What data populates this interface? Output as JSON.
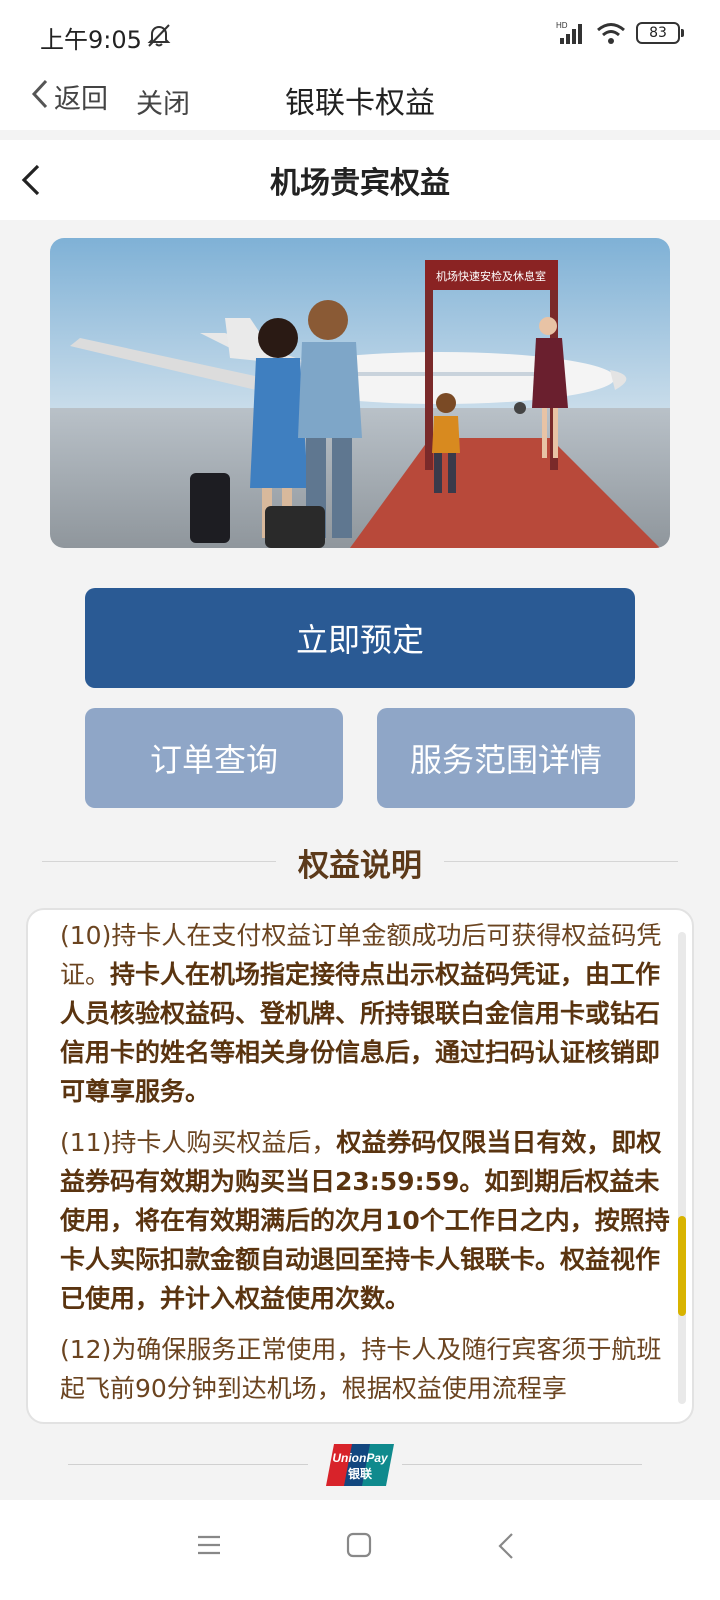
{
  "status_bar": {
    "time": "上午9:05",
    "battery": "83",
    "network": "HD"
  },
  "nav": {
    "back_label": "返回",
    "close_label": "关闭",
    "title": "银联卡权益"
  },
  "page": {
    "title": "机场贵宾权益"
  },
  "banner": {
    "sign_text": "机场快速安检及休息室"
  },
  "actions": {
    "primary": "立即预定",
    "orders": "订单查询",
    "scope": "服务范围详情"
  },
  "section": {
    "title": "权益说明"
  },
  "terms": [
    {
      "normal": "(10)持卡人在支付权益订单金额成功后可获得权益码凭证。",
      "bold": "持卡人在机场指定接待点出示权益码凭证，由工作人员核验权益码、登机牌、所持银联白金信用卡或钻石信用卡的姓名等相关身份信息后，通过扫码认证核销即可尊享服务。"
    },
    {
      "normal": "(11)持卡人购买权益后，",
      "bold": "权益券码仅限当日有效，即权益券码有效期为购买当日23:59:59。如到期后权益未使用，将在有效期满后的次月10个工作日之内，按照持卡人实际扣款金额自动退回至持卡人银联卡。权益视作已使用，并计入权益使用次数。"
    },
    {
      "normal": "(12)为确保服务正常使用，持卡人及随行宾客须于航班起飞前90分钟到达机场，根据权益使用流程享",
      "bold": ""
    }
  ],
  "footer": {
    "logo_text_top": "UnionPay",
    "logo_text_bottom": "银联"
  },
  "colors": {
    "primary_button": "#2a5a94",
    "secondary_button": "#8fa6c7",
    "section_title": "#5c3a1a",
    "scroll_thumb": "#d8b300"
  }
}
